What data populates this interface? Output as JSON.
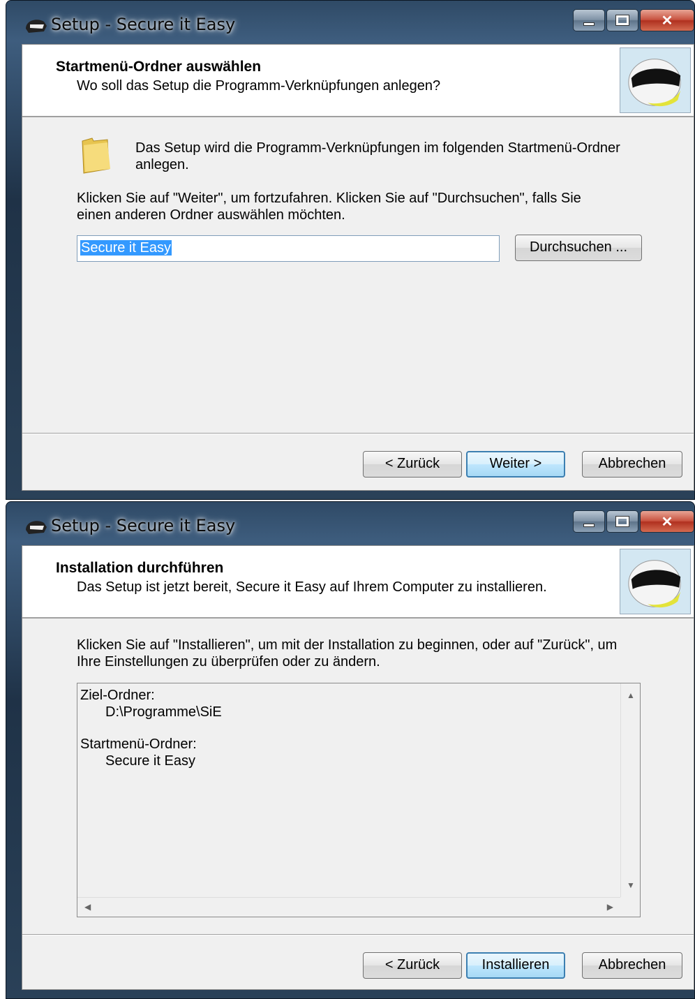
{
  "windows": [
    {
      "title": "Setup - Secure it Easy",
      "header_title": "Startmenü-Ordner auswählen",
      "header_subtitle": "Wo soll das Setup die Programm-Verknüpfungen anlegen?",
      "intro_line1": "Das Setup wird die Programm-Verknüpfungen im folgenden Startmenü-Ordner",
      "intro_line2": "anlegen.",
      "instruction_line1": "Klicken Sie auf \"Weiter\", um fortzufahren. Klicken Sie auf \"Durchsuchen\", falls Sie",
      "instruction_line2": "einen anderen Ordner auswählen möchten.",
      "folder_value": "Secure it Easy",
      "browse_label": "Durchsuchen ...",
      "back_label": "< Zurück",
      "next_label": "Weiter >",
      "cancel_label": "Abbrechen"
    },
    {
      "title": "Setup - Secure it Easy",
      "header_title": "Installation durchführen",
      "header_subtitle": "Das Setup ist jetzt bereit, Secure it Easy auf Ihrem Computer zu installieren.",
      "instruction_line1": "Klicken Sie auf \"Installieren\", um mit der Installation zu beginnen, oder auf \"Zurück\", um",
      "instruction_line2": "Ihre Einstellungen zu überprüfen oder zu ändern.",
      "summary": {
        "target_label": "Ziel-Ordner:",
        "target_value": "D:\\Programme\\SiE",
        "startmenu_label": "Startmenü-Ordner:",
        "startmenu_value": "Secure it Easy"
      },
      "back_label": "< Zurück",
      "next_label": "Installieren",
      "cancel_label": "Abbrechen"
    }
  ],
  "icons": [
    "helmet-app-icon",
    "helmet-logo-icon",
    "folder-icon",
    "minimize-icon",
    "maximize-icon",
    "close-icon"
  ],
  "colors": {
    "selection": "#3399ff",
    "default_button_border": "#3c7fb1",
    "close_button": "#c8513e"
  }
}
